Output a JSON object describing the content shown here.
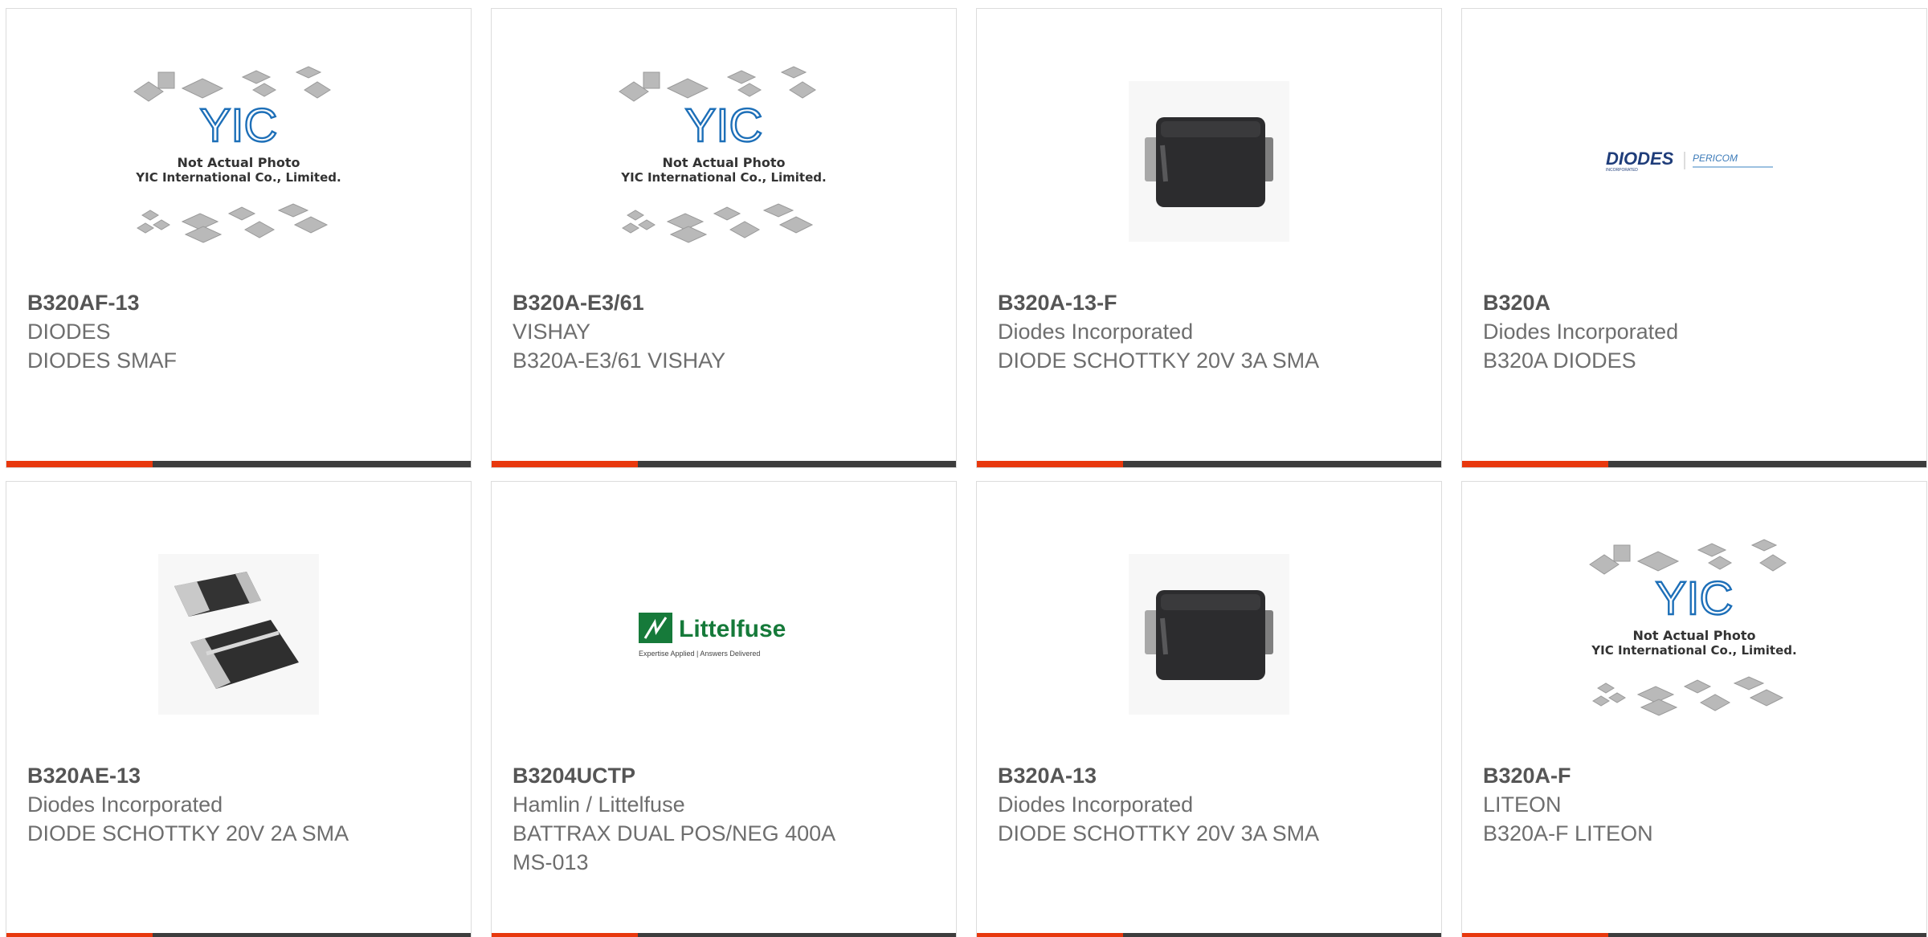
{
  "theme": {
    "accent": "#e8380d",
    "bar": "#3d3d3d",
    "text": "#6e6e6e",
    "title": "#555555"
  },
  "placeholder": {
    "brand": "YIC",
    "line1": "Not Actual Photo",
    "line2": "YIC International Co., Limited."
  },
  "logos": {
    "diodes": {
      "name": "DIODES",
      "sub": "INCORPORATED",
      "pericom": "PERICOM"
    },
    "littelfuse": {
      "name": "Littelfuse",
      "tagline": "Expertise Applied | Answers Delivered"
    }
  },
  "products": [
    {
      "part": "B320AF-13",
      "manufacturer": "DIODES",
      "description": "DIODES SMAF",
      "image": "placeholder"
    },
    {
      "part": "B320A-E3/61",
      "manufacturer": "VISHAY",
      "description": "B320A-E3/61 VISHAY",
      "image": "placeholder"
    },
    {
      "part": "B320A-13-F",
      "manufacturer": "Diodes Incorporated",
      "description": "DIODE SCHOTTKY 20V 3A SMA",
      "image": "sma-package"
    },
    {
      "part": "B320A",
      "manufacturer": "Diodes Incorporated",
      "description": "B320A DIODES",
      "image": "diodes-logo"
    },
    {
      "part": "B320AE-13",
      "manufacturer": "Diodes Incorporated",
      "description": "DIODE SCHOTTKY 20V 2A SMA",
      "image": "sma-pair"
    },
    {
      "part": "B3204UCTP",
      "manufacturer": "Hamlin / Littelfuse",
      "description": "BATTRAX DUAL POS/NEG 400A MS-013",
      "image": "littelfuse-logo"
    },
    {
      "part": "B320A-13",
      "manufacturer": "Diodes Incorporated",
      "description": "DIODE SCHOTTKY 20V 3A SMA",
      "image": "sma-package"
    },
    {
      "part": "B320A-F",
      "manufacturer": "LITEON",
      "description": "B320A-F LITEON",
      "image": "placeholder"
    }
  ]
}
